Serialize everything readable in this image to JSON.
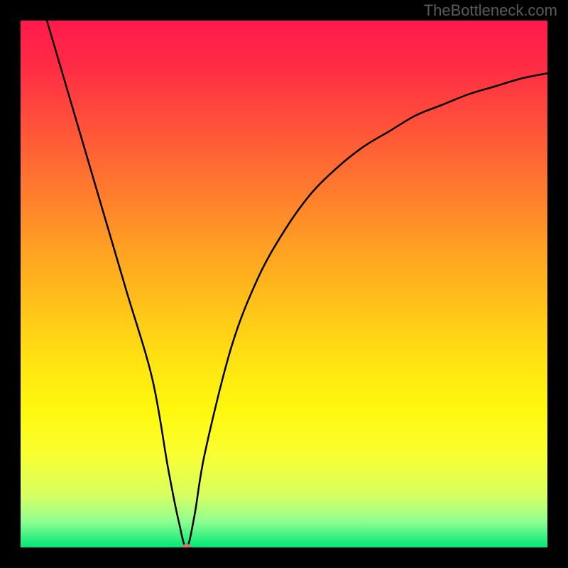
{
  "watermark": "TheBottleneck.com",
  "chart_data": {
    "type": "line",
    "title": "",
    "xlabel": "",
    "ylabel": "",
    "xlim": [
      0,
      100
    ],
    "ylim": [
      0,
      100
    ],
    "series": [
      {
        "name": "bottleneck-curve",
        "x": [
          5,
          10,
          15,
          20,
          25,
          28,
          30,
          31.5,
          33,
          35,
          40,
          45,
          50,
          55,
          60,
          65,
          70,
          75,
          80,
          85,
          90,
          95,
          100
        ],
        "values": [
          100,
          83,
          66,
          49,
          32,
          15,
          5,
          0,
          6,
          18,
          38,
          51,
          60,
          67,
          72,
          76,
          79,
          82,
          84,
          86,
          87.5,
          89,
          90
        ]
      }
    ],
    "marker": {
      "x": 31.5,
      "y": 0,
      "color": "#c97e70"
    },
    "gradient_colors_top_to_bottom": [
      "#ff1a4d",
      "#ff7a2e",
      "#ffe412",
      "#00e878"
    ]
  }
}
